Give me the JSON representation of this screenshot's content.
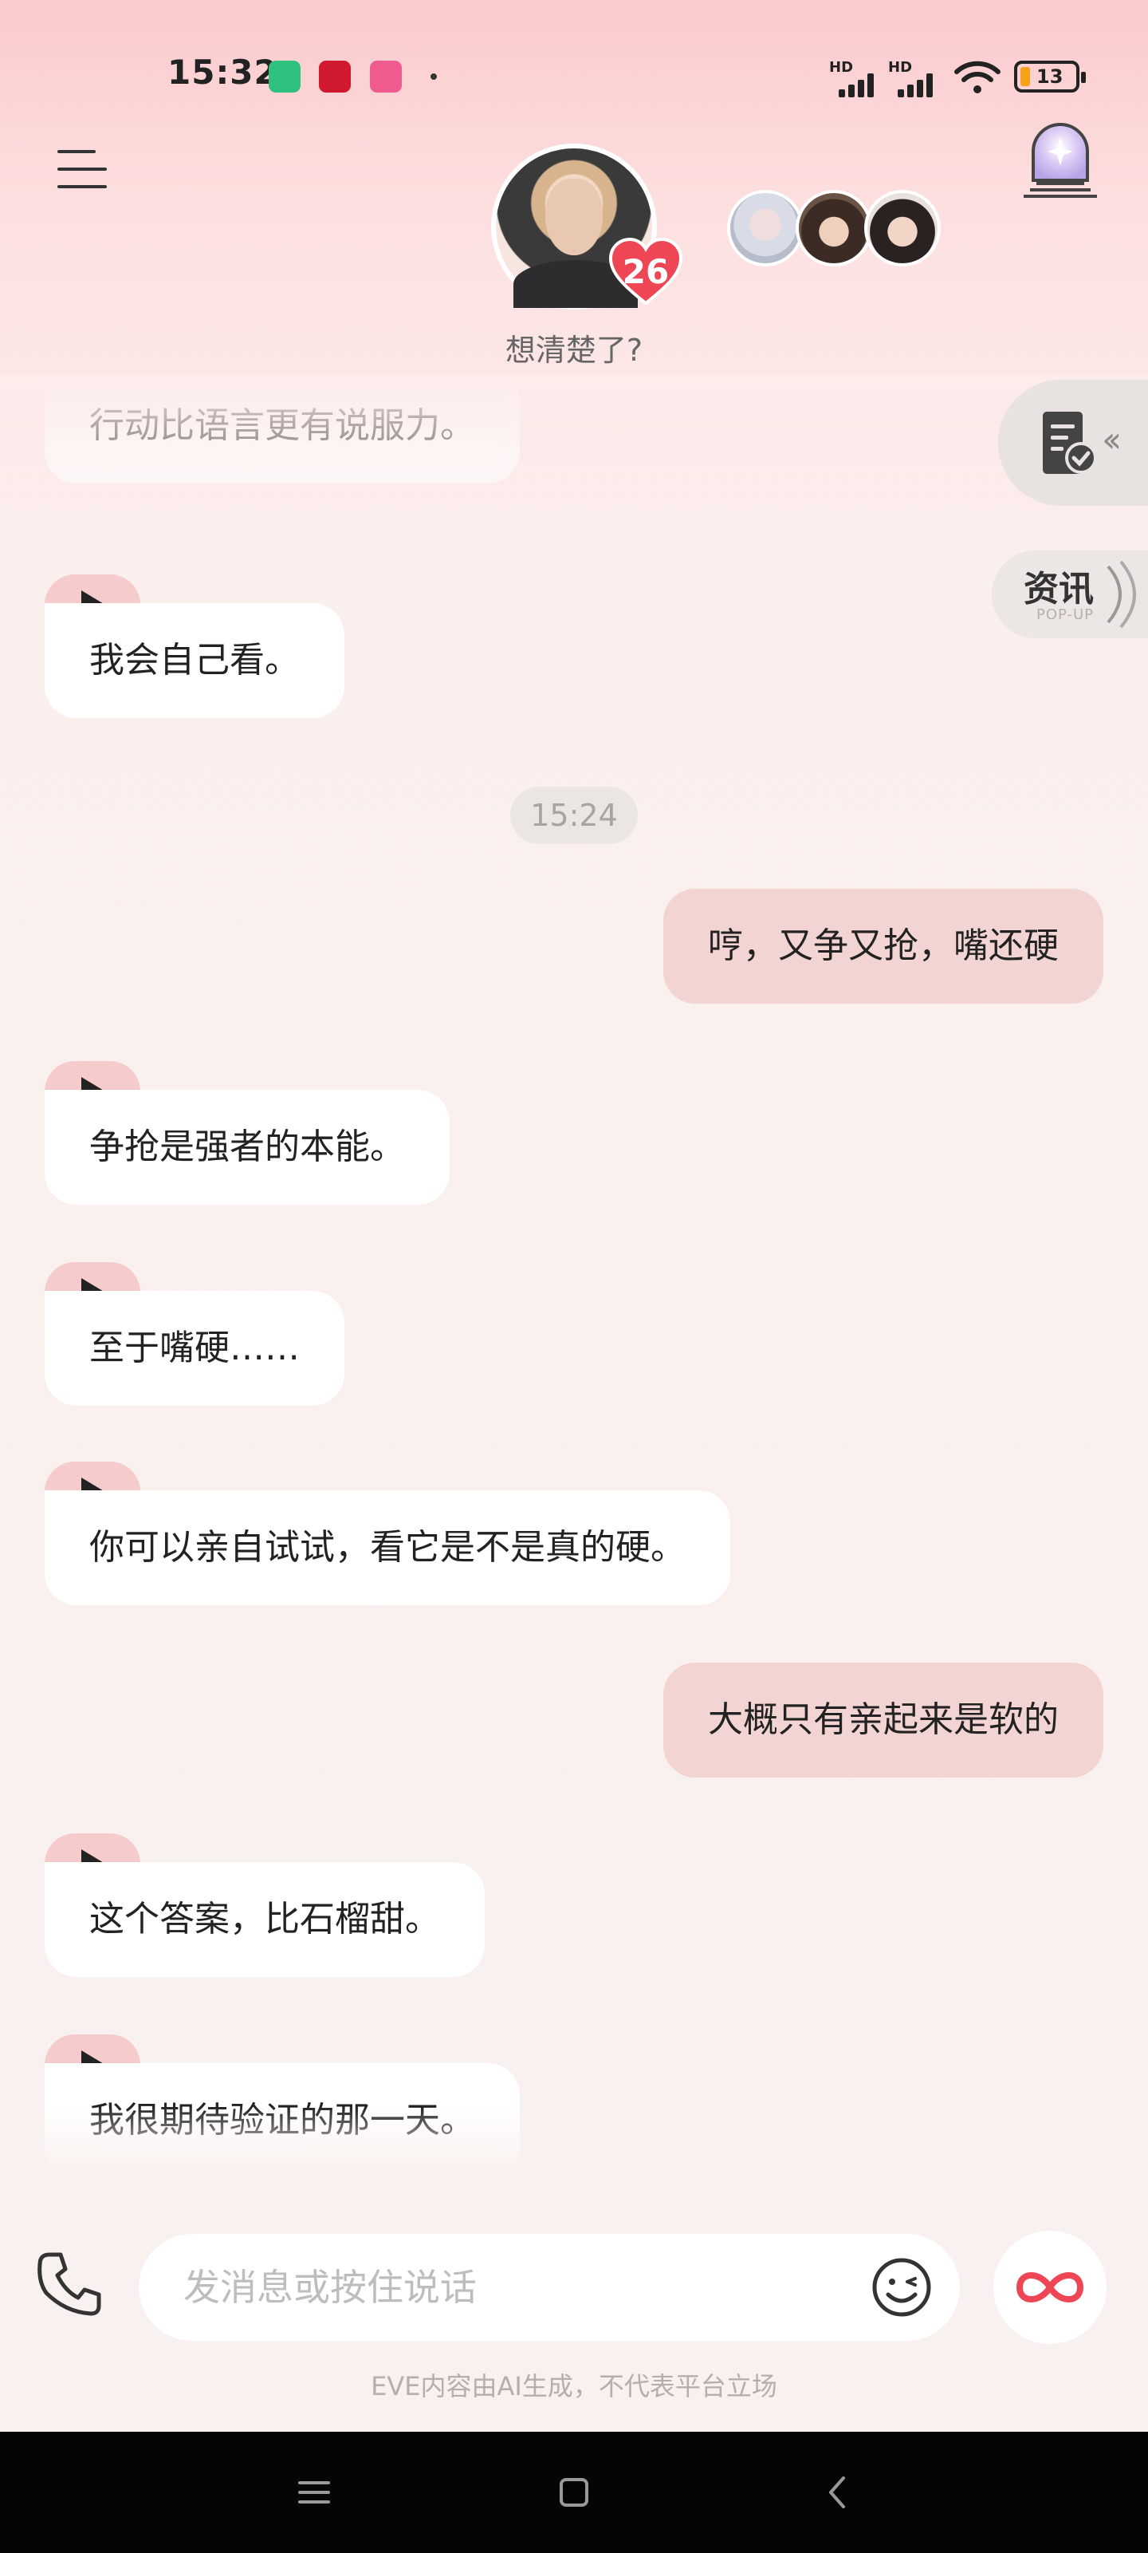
{
  "status_bar": {
    "time": "15:32",
    "app_icons": [
      "shield-app-icon",
      "heart-app-icon",
      "bilibili-icon"
    ],
    "signal_labels": [
      "HD",
      "HD"
    ],
    "battery_level": "13",
    "colors": {
      "battery_fill": "#f6a21a"
    }
  },
  "header": {
    "character_affinity": "26",
    "subtitle": "想清楚了?",
    "accent": "#ee4654"
  },
  "floats": {
    "news_label": "资讯",
    "news_sub": "POP-UP"
  },
  "chat": {
    "messages": [
      {
        "from": "ai",
        "text": "行动比语言更有说服力。"
      },
      {
        "from": "ai",
        "text": "我会自己看。"
      },
      {
        "type": "time",
        "text": "15:24"
      },
      {
        "from": "user",
        "text": "哼，又争又抢，嘴还硬"
      },
      {
        "from": "ai",
        "text": "争抢是强者的本能。"
      },
      {
        "from": "ai",
        "text": "至于嘴硬……"
      },
      {
        "from": "ai",
        "text": "你可以亲自试试，看它是不是真的硬。"
      },
      {
        "from": "user",
        "text": "大概只有亲起来是软的"
      },
      {
        "from": "ai",
        "text": "这个答案，比石榴甜。"
      },
      {
        "from": "ai",
        "text": "我很期待验证的那一天。"
      }
    ],
    "colors": {
      "ai_bubble": "#ffffff",
      "user_bubble": "#f2d4d2",
      "play_tab": "#f6cbcc"
    }
  },
  "input": {
    "placeholder": "发消息或按住说话"
  },
  "disclaimer": "EVE内容由AI生成，不代表平台立场"
}
